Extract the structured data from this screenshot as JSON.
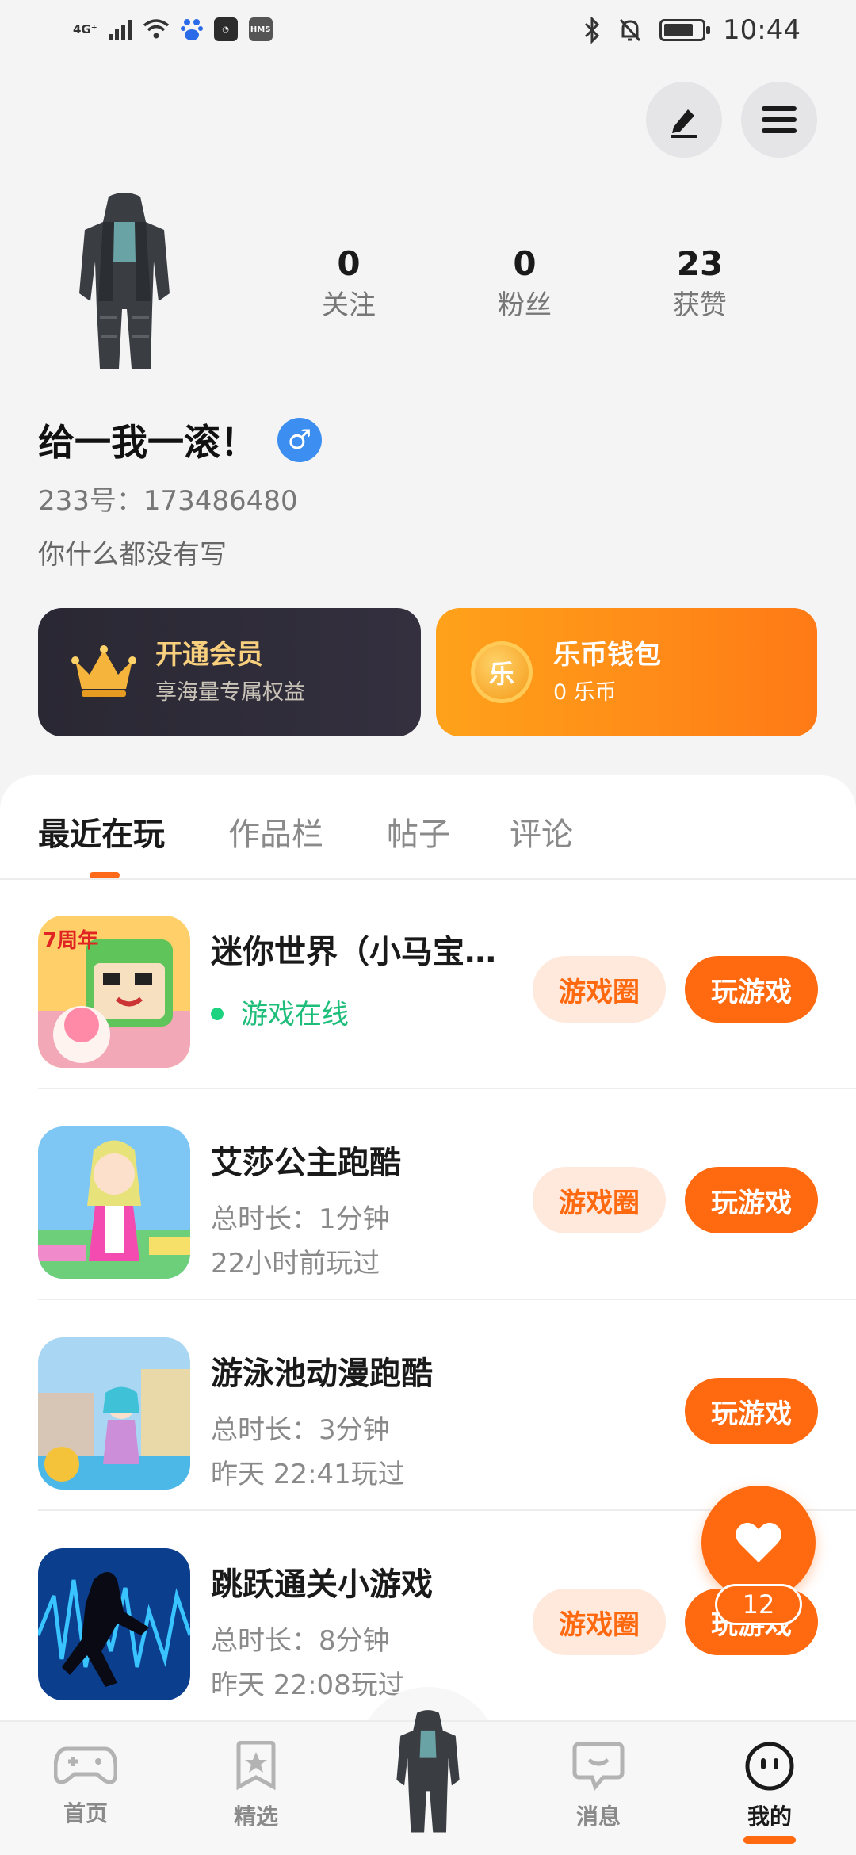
{
  "status_bar": {
    "network": "4G⁺",
    "app_icon_label": "HMS",
    "time": "10:44"
  },
  "profile": {
    "stats": [
      {
        "value": "0",
        "label": "关注"
      },
      {
        "value": "0",
        "label": "粉丝"
      },
      {
        "value": "23",
        "label": "获赞"
      }
    ],
    "name": "给一我一滚！",
    "gender_symbol": "♂",
    "id_line": "233号：173486480",
    "bio": "你什么都没有写"
  },
  "cards": {
    "vip": {
      "title": "开通会员",
      "subtitle": "享海量专属权益"
    },
    "wallet": {
      "title": "乐币钱包",
      "subtitle": "0 乐币",
      "coin_char": "乐"
    }
  },
  "tabs": [
    "最近在玩",
    "作品栏",
    "帖子",
    "评论"
  ],
  "games": [
    {
      "title": "迷你世界（小马宝…",
      "line1": "游戏在线",
      "line2": "",
      "circle_label": "游戏圈",
      "play_label": "玩游戏"
    },
    {
      "title": "艾莎公主跑酷",
      "line1": "总时长：1分钟",
      "line2": "22小时前玩过",
      "circle_label": "游戏圈",
      "play_label": "玩游戏"
    },
    {
      "title": "游泳池动漫跑酷",
      "line1": "总时长：3分钟",
      "line2": "昨天 22:41玩过",
      "play_label": "玩游戏"
    },
    {
      "title": "跳跃通关小游戏",
      "line1": "总时长：8分钟",
      "line2": "昨天 22:08玩过",
      "circle_label": "游戏圈",
      "play_label": "玩游戏"
    }
  ],
  "thumb_badge": "7周年",
  "fab": {
    "count": "12"
  },
  "bottom_nav": [
    "首页",
    "精选",
    "消息",
    "我的"
  ],
  "colors": {
    "accent": "#ff6a10",
    "online": "#1dbd7a"
  }
}
